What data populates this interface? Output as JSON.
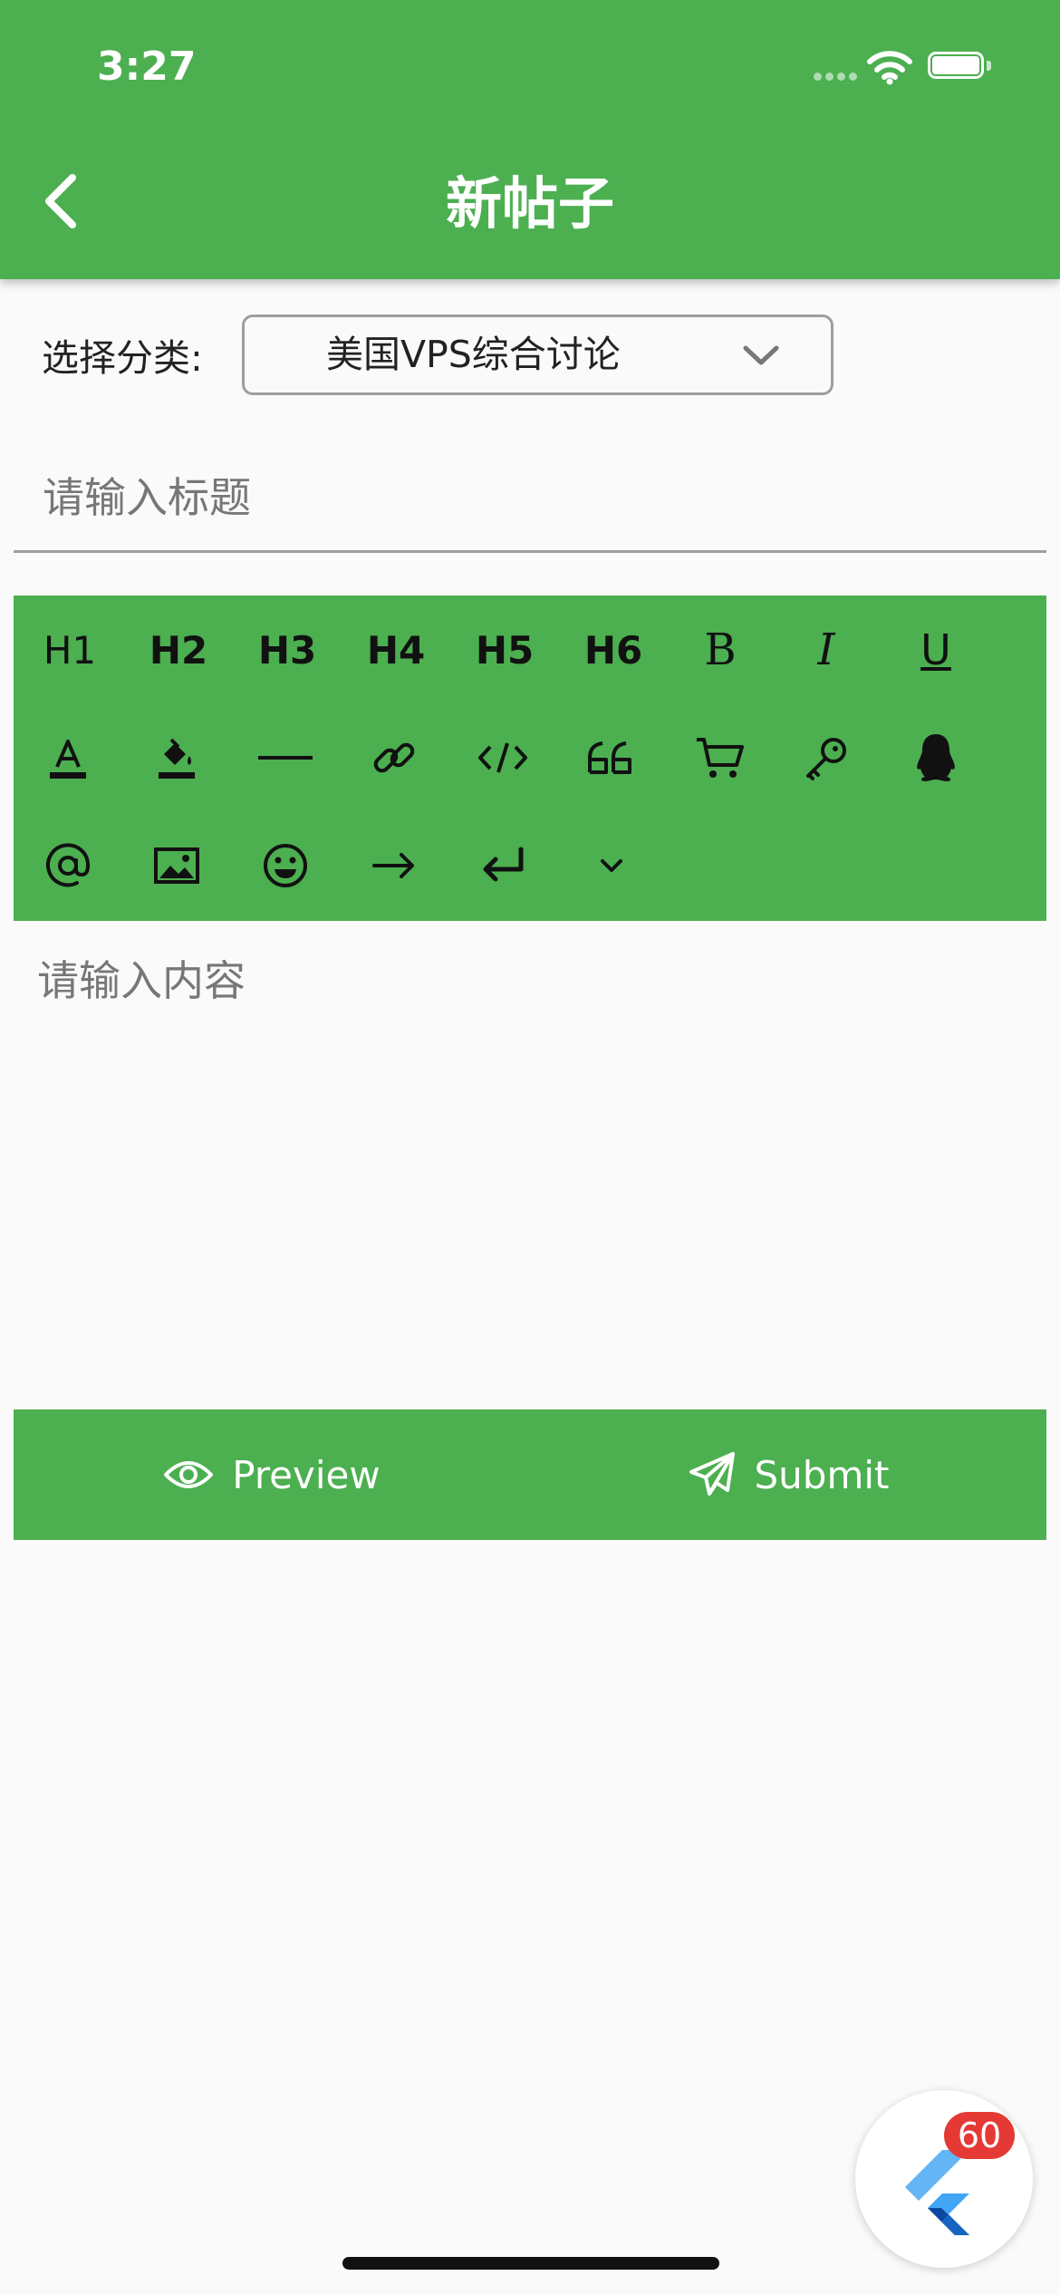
{
  "status_bar": {
    "time": "3:27"
  },
  "app_bar": {
    "title": "新帖子",
    "back_icon": "chevron-left-icon"
  },
  "category": {
    "label": "选择分类:",
    "selected": "美国VPS综合讨论",
    "dropdown_icon": "chevron-down-icon"
  },
  "title_input": {
    "placeholder": "请输入标题",
    "value": ""
  },
  "toolbar": {
    "row1": [
      "H1",
      "H2",
      "H3",
      "H4",
      "H5",
      "H6",
      "B",
      "I",
      "U"
    ],
    "row2_icons": [
      "text-color-icon",
      "fill-color-icon",
      "horizontal-rule-icon",
      "link-icon",
      "code-icon",
      "quote-icon",
      "cart-icon",
      "key-icon",
      "qq-icon"
    ],
    "row3_icons": [
      "mention-icon",
      "image-icon",
      "emoji-icon",
      "arrow-right-icon",
      "enter-icon",
      "chevron-down-icon"
    ]
  },
  "content_input": {
    "placeholder": "请输入内容",
    "value": ""
  },
  "actions": {
    "preview_label": "Preview",
    "submit_label": "Submit"
  },
  "debug_badge": {
    "count": "60"
  },
  "colors": {
    "primary": "#4caf50",
    "background": "#fafafa",
    "badge": "#e53935"
  }
}
